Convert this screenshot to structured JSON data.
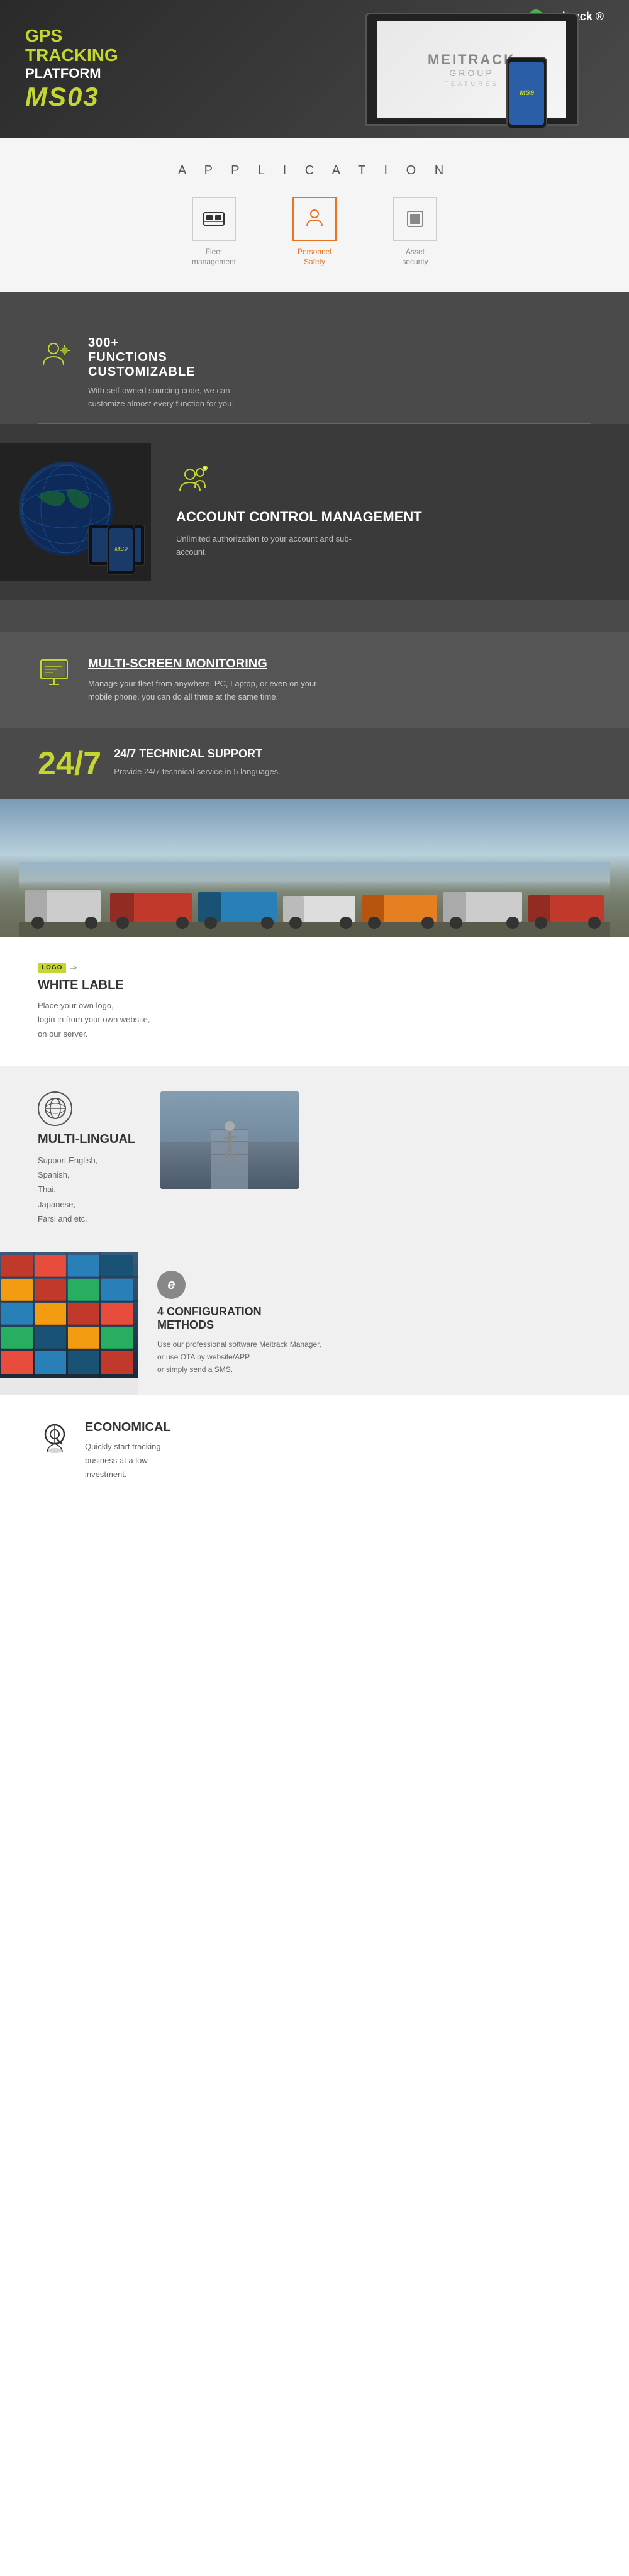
{
  "brand": {
    "logo_letter": "G",
    "logo_name": "meitrack",
    "logo_symbol": "®"
  },
  "hero": {
    "gps_label": "GPS",
    "tracking_label": "Tracking",
    "platform_label": "Platform",
    "model": "MS03",
    "screen_brand": "MEITRACK",
    "screen_group": "GROUP",
    "screen_sub": "FEATURES"
  },
  "application": {
    "section_title": "A P P L I C A T I O N",
    "icons": [
      {
        "label": "Fleet\nmanagement",
        "color": "default",
        "type": "fleet"
      },
      {
        "label": "Personnel\nSafety",
        "color": "orange",
        "type": "person"
      },
      {
        "label": "Asset\nsecurity",
        "color": "default",
        "type": "asset"
      }
    ]
  },
  "features": {
    "functions": {
      "icon": "👤",
      "title": "300+\nFUNCTIONS\nCUSTOMIZABLE",
      "desc": "With self-owned sourcing code, we can customize almost every function for you."
    },
    "account": {
      "icon": "👥",
      "title": "ACCOUNT CONTROL\nMANAGEMENT",
      "desc": "Unlimited authorization to your account and sub-account."
    },
    "multiscreen": {
      "icon": "🖥",
      "title": "MULTI-SCREEN MONITORING",
      "desc": "Manage your fleet from anywhere, PC, Laptop, or even on your mobile phone, you can do all three at the same time."
    },
    "support": {
      "number": "24/7",
      "title": "24/7 TECHNICAL\nSUPPORT",
      "desc": "Provide 24/7 technical service in 5 languages."
    }
  },
  "whitelabel": {
    "logo_text": "LOGO",
    "title": "WHITE LABLE",
    "desc": "Place your own logo,\nlogin in from your own website,\non our server."
  },
  "multilingual": {
    "title": "MULTI-LINGUAL",
    "desc": "Support English,\nSpanish,\nThai,\nJapanese,\nFarsi and etc."
  },
  "config": {
    "title": "4 CONFIGURATION\nMETHODS",
    "desc": "Use our professional software Meitrack Manager,\nor use OTA by website/APP,\nor simply send a SMS."
  },
  "economical": {
    "title": "ECONOMICAL",
    "desc": "Quickly start tracking\nbusiness at a low\ninvestment."
  }
}
